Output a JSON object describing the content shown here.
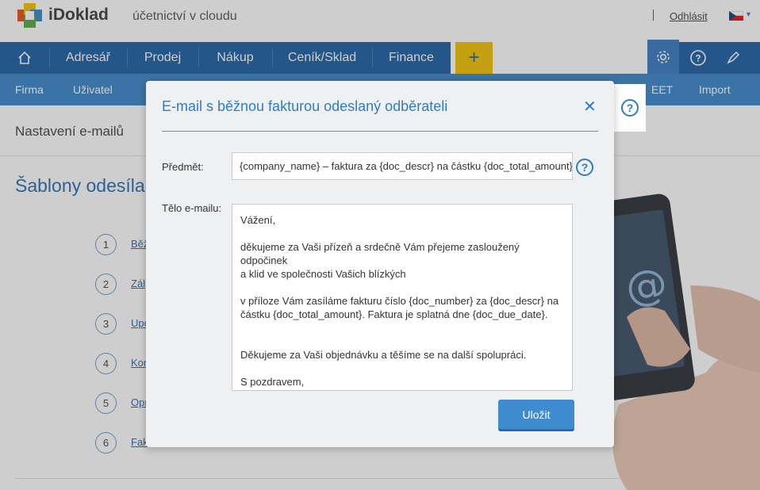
{
  "header": {
    "brand": "iDoklad",
    "tagline": "účetnictví v cloudu",
    "logout": "Odhlásit"
  },
  "main_nav": {
    "items": [
      "Adresář",
      "Prodej",
      "Nákup",
      "Ceník/Sklad",
      "Finance"
    ],
    "plus": "+"
  },
  "sub_nav": {
    "items": [
      "Firma",
      "Uživatel",
      "EET",
      "Import"
    ]
  },
  "page": {
    "title": "Nastavení e-mailů",
    "section_title": "Šablony odesílan",
    "steps": [
      {
        "num": "1",
        "label": "Běž"
      },
      {
        "num": "2",
        "label": "Zál"
      },
      {
        "num": "3",
        "label": "Upo"
      },
      {
        "num": "4",
        "label": "Kor"
      },
      {
        "num": "5",
        "label": "Opr"
      },
      {
        "num": "6",
        "label": "Fak"
      }
    ]
  },
  "modal": {
    "title": "E-mail s běžnou fakturou odeslaný odběrateli",
    "subject_label": "Předmět:",
    "subject_value": "{company_name} – faktura za {doc_descr} na částku {doc_total_amount}",
    "body_label": "Tělo e-mailu:",
    "body_lines": {
      "greeting": "Vážení,",
      "thanks_1": "děkujeme za Vaši přízeň a srdečně Vám přejeme zasloužený odpočinek",
      "thanks_2": "a klid ve společnosti Vašich blízkých",
      "invoice_1": "v příloze Vám zasíláme fakturu číslo {doc_number} za {doc_descr} na",
      "invoice_2": "částku {doc_total_amount}. Faktura je splatná dne {doc_due_date}.",
      "order": "Děkujeme za Vaši objednávku a těšíme se na další spolupráci.",
      "closing": "S pozdravem,"
    },
    "help_glyph": "?",
    "close_glyph": "✕",
    "save_label": "Uložit"
  },
  "icons": {
    "home": "home-icon",
    "gear": "gear-icon",
    "help": "help-icon",
    "rocket": "rocket-icon",
    "flag": "czech-flag-icon"
  },
  "colors": {
    "nav_primary": "#1e5fa3",
    "nav_secondary": "#3a86c8",
    "accent_yellow": "#f2c100",
    "link_blue": "#2f7dc1"
  }
}
